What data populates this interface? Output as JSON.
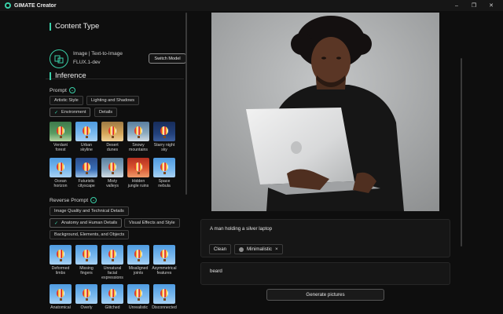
{
  "app": {
    "title": "GIMATE Creator"
  },
  "window_controls": [
    "–",
    "❐",
    "✕"
  ],
  "content_type": {
    "title": "Content Type",
    "model_type": "Image | Text-to-Image",
    "model_name": "FLUX.1-dev",
    "switch_label": "Switch Model"
  },
  "inference": {
    "title": "Inference",
    "prompt_label": "Prompt",
    "prompt_tabs": [
      "Artistic Style",
      "Lighting and Shadows",
      "Environment",
      "Details"
    ],
    "prompt_tiles": [
      [
        "Verdant",
        "forest"
      ],
      [
        "Urban",
        "skyline"
      ],
      [
        "Desert",
        "dunes"
      ],
      [
        "Snowy",
        "mountains"
      ],
      [
        "Starry night",
        "sky"
      ],
      [
        "Ocean",
        "horizon"
      ],
      [
        "Futuristic",
        "cityscape"
      ],
      [
        "Misty",
        "valleys"
      ],
      [
        "Hidden",
        "jungle ruins"
      ],
      [
        "Space",
        "nebula"
      ]
    ],
    "reverse_label": "Reverse Prompt",
    "reverse_tabs": [
      "Image Quality and Technical Details",
      "Anatomy and Human Details",
      "Visual Effects and Style",
      "Background, Elements, and Objects"
    ],
    "reverse_tiles": [
      [
        "Deformed",
        "limbs",
        ""
      ],
      [
        "Missing",
        "fingers",
        ""
      ],
      [
        "Unnatural",
        "facial",
        "expressions"
      ],
      [
        "Misaligned",
        "joints",
        ""
      ],
      [
        "Asymmetrical",
        "features",
        ""
      ],
      [
        "Anatomical",
        "",
        ""
      ],
      [
        "Overly",
        "",
        ""
      ],
      [
        "Glitched",
        "",
        ""
      ],
      [
        "Unrealistic",
        "",
        ""
      ],
      [
        "Disconnected",
        "",
        ""
      ]
    ]
  },
  "generation": {
    "prompt_text": "A man holding a silver laptop",
    "clean_label": "Clean",
    "style_tag": "Minimalistic",
    "tag_close": "×",
    "negative_text": "beard",
    "generate_label": "Generate pictures"
  },
  "colors": {
    "accent": "#3ad0a8",
    "background": "#0e0e0e",
    "panel": "#161616"
  },
  "icons": {
    "app": "app-logo-icon",
    "model": "image-model-icon",
    "chevron": "chevron-down-icon",
    "check": "check-icon",
    "close": "close-icon"
  }
}
